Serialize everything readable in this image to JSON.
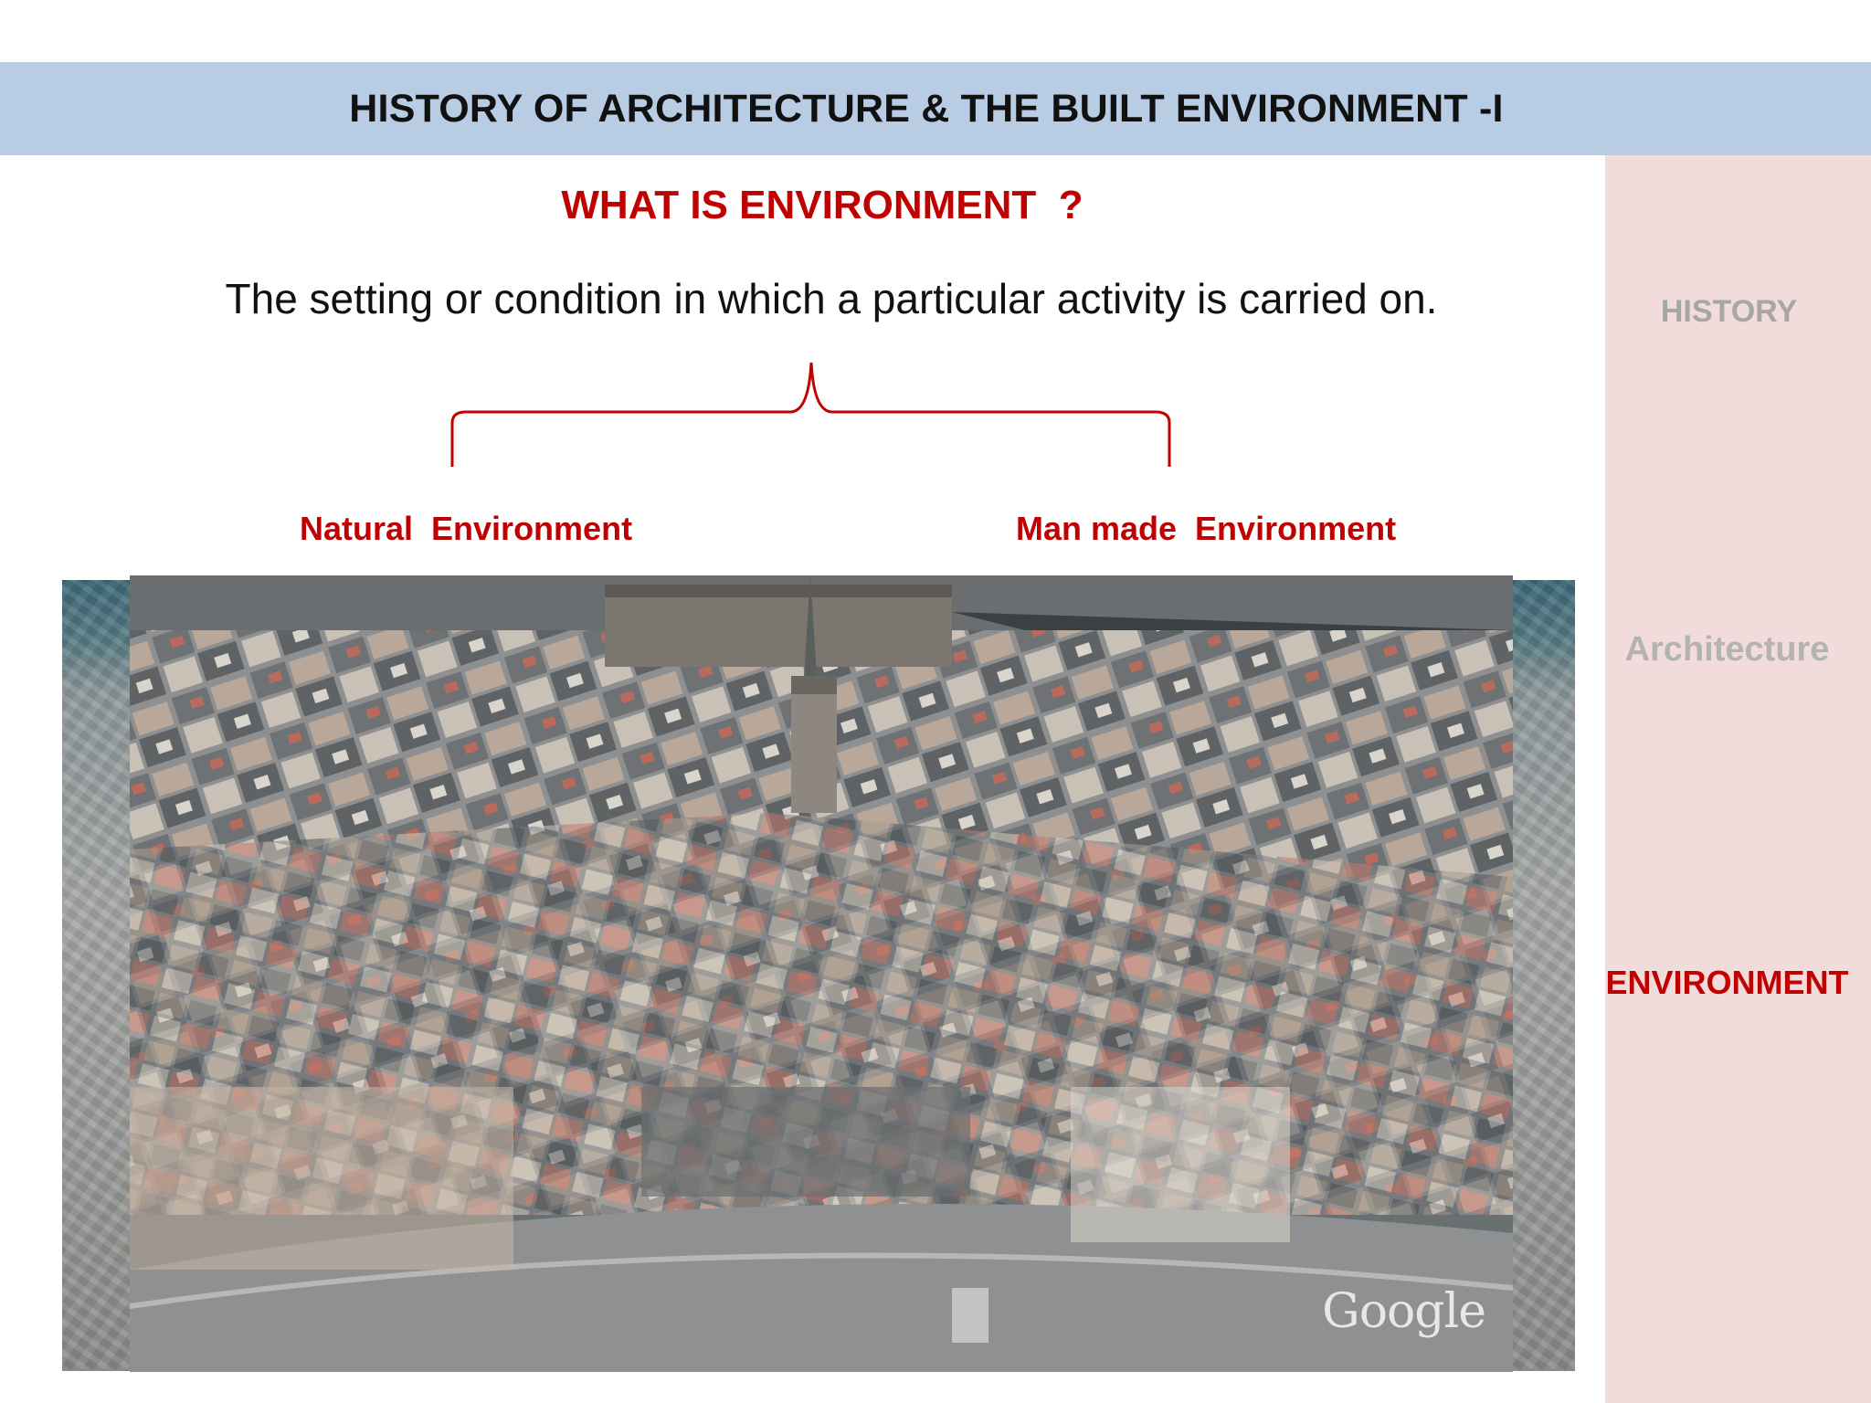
{
  "header": {
    "title": "HISTORY OF ARCHITECTURE & THE BUILT ENVIRONMENT -I"
  },
  "content": {
    "question": "WHAT IS ENVIRONMENT  ?",
    "definition": "The setting or condition in which a particular activity is carried on.",
    "natural_label": "Natural  Environment",
    "manmade_label": "Man made  Environment"
  },
  "photo": {
    "watermark": "Google"
  },
  "sidebar": {
    "items": [
      {
        "label": "HISTORY",
        "active": false
      },
      {
        "label": "Architecture",
        "active": false
      },
      {
        "label": "ENVIRONMENT",
        "active": true
      }
    ]
  },
  "colors": {
    "header_bg": "#b8cce4",
    "sidebar_bg": "#f2dcdb",
    "accent_red": "#c00000",
    "inactive_gray": "#a6a6a6"
  }
}
